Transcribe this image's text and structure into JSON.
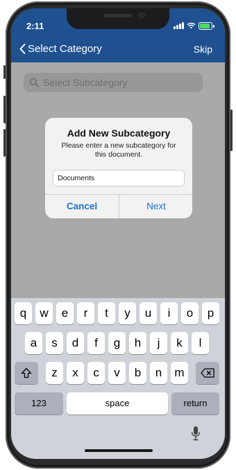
{
  "status_bar": {
    "time": "2:11"
  },
  "nav": {
    "back_label": "Select Category",
    "skip_label": "Skip"
  },
  "search": {
    "placeholder": "Select Subcategory"
  },
  "dialog": {
    "title": "Add New Subcategory",
    "message": "Please enter a new subcategory for this document.",
    "input_value": "Documents",
    "cancel_label": "Cancel",
    "next_label": "Next"
  },
  "keyboard": {
    "row1": [
      "q",
      "w",
      "e",
      "r",
      "t",
      "y",
      "u",
      "i",
      "o",
      "p"
    ],
    "row2": [
      "a",
      "s",
      "d",
      "f",
      "g",
      "h",
      "j",
      "k",
      "l"
    ],
    "row3": [
      "z",
      "x",
      "c",
      "v",
      "b",
      "n",
      "m"
    ],
    "numbers_label": "123",
    "space_label": "space",
    "return_label": "return"
  },
  "colors": {
    "nav_bar": "#1f5190",
    "accent": "#1e73d6",
    "battery": "#4cd964"
  }
}
